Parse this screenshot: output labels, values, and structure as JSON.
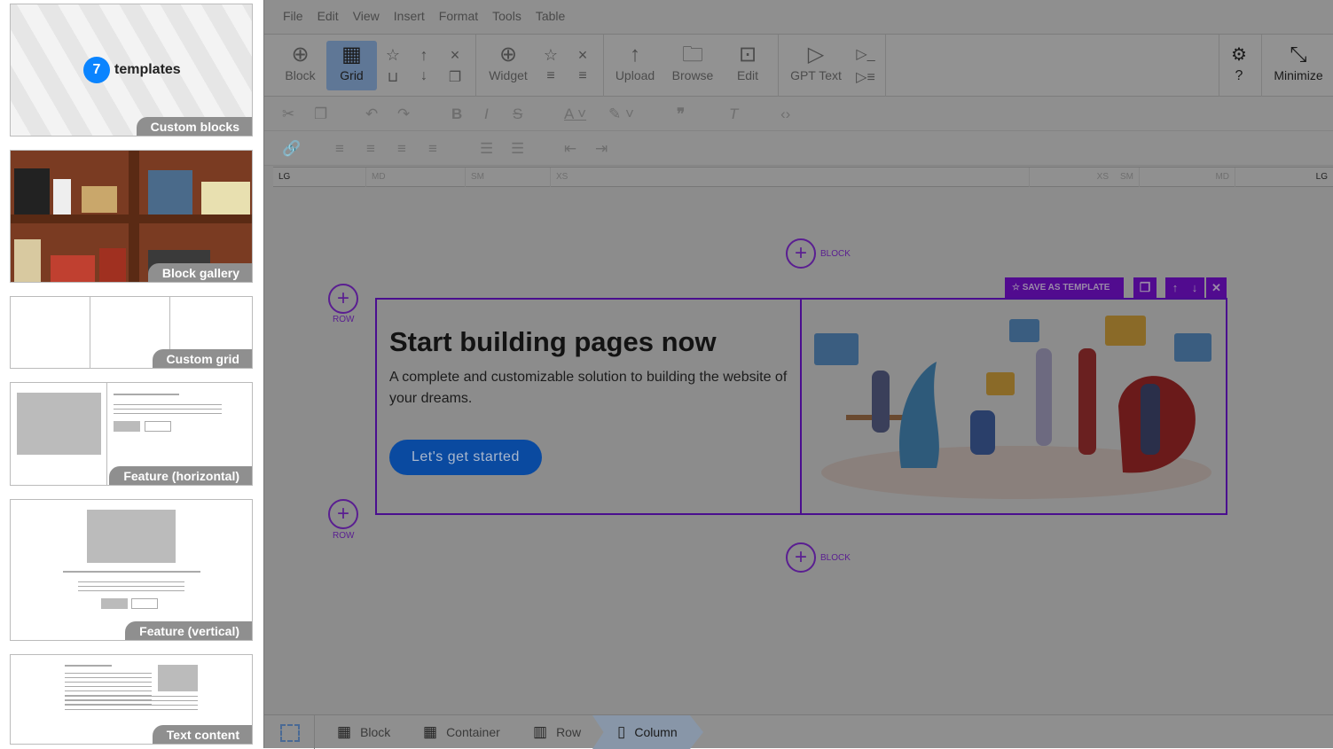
{
  "sidebar": {
    "cards": [
      {
        "label": "Custom blocks",
        "count": "7",
        "count_text": "templates"
      },
      {
        "label": "Block gallery"
      },
      {
        "label": "Custom grid"
      },
      {
        "label": "Feature (horizontal)"
      },
      {
        "label": "Feature (vertical)"
      },
      {
        "label": "Text content"
      }
    ]
  },
  "menu": [
    "File",
    "Edit",
    "View",
    "Insert",
    "Format",
    "Tools",
    "Table"
  ],
  "toolbar": {
    "block": "Block",
    "grid": "Grid",
    "widget": "Widget",
    "upload": "Upload",
    "browse": "Browse",
    "edit": "Edit",
    "gpt": "GPT Text",
    "minimize": "Minimize",
    "active": "Grid"
  },
  "ruler": {
    "left": [
      "LG",
      "MD",
      "SM",
      "XS"
    ],
    "right": [
      "XS",
      "SM",
      "MD",
      "LG"
    ]
  },
  "canvas": {
    "block_label": "BLOCK",
    "row_label": "ROW",
    "save_template": "SAVE AS TEMPLATE",
    "heading": "Start building pages now",
    "text": "A complete and customizable solution to building the website of your dreams.",
    "cta": "Let's get started"
  },
  "breadcrumb": [
    "Block",
    "Container",
    "Row",
    "Column"
  ],
  "colors": {
    "accent": "#510b8f",
    "cta": "#0a4aa0",
    "badge": "#0a84ff"
  }
}
